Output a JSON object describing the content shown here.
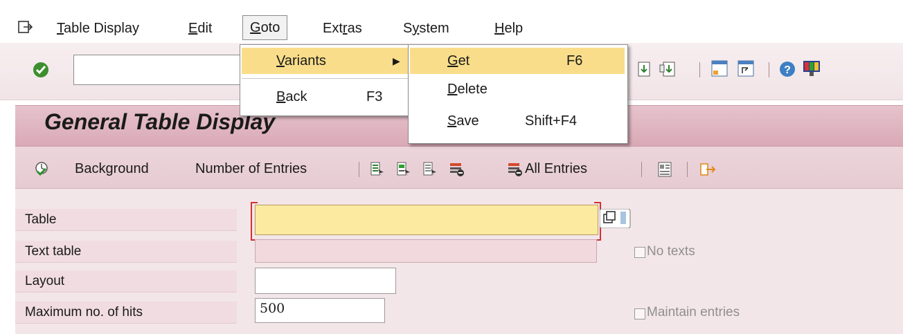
{
  "menubar": {
    "items": [
      {
        "label": "Table Display",
        "mnemonic": "T"
      },
      {
        "label": "Edit",
        "mnemonic": "E"
      },
      {
        "label": "Goto",
        "mnemonic": "G"
      },
      {
        "label": "Extras",
        "mnemonic": "r"
      },
      {
        "label": "System",
        "mnemonic": "y"
      },
      {
        "label": "Help",
        "mnemonic": "H"
      }
    ]
  },
  "goto_menu": {
    "variants_label": "Variants",
    "back_label": "Back",
    "back_shortcut": "F3"
  },
  "variants_menu": {
    "get_label": "Get",
    "get_shortcut": "F6",
    "delete_label": "Delete",
    "save_label": "Save",
    "save_shortcut": "Shift+F4"
  },
  "title": "General Table Display",
  "app_toolbar": {
    "background": "Background",
    "number_of_entries": "Number of Entries",
    "all_entries": "All Entries"
  },
  "form": {
    "table_label": "Table",
    "text_table_label": "Text table",
    "layout_label": "Layout",
    "max_hits_label": "Maximum no. of hits",
    "max_hits_value": "500",
    "no_texts_label": "No texts",
    "maintain_entries_label": "Maintain entries"
  },
  "colors": {
    "title_bar": "#d9a9b6",
    "menu_highlight": "#f9dd8a",
    "required_field": "#fbeaa0"
  }
}
